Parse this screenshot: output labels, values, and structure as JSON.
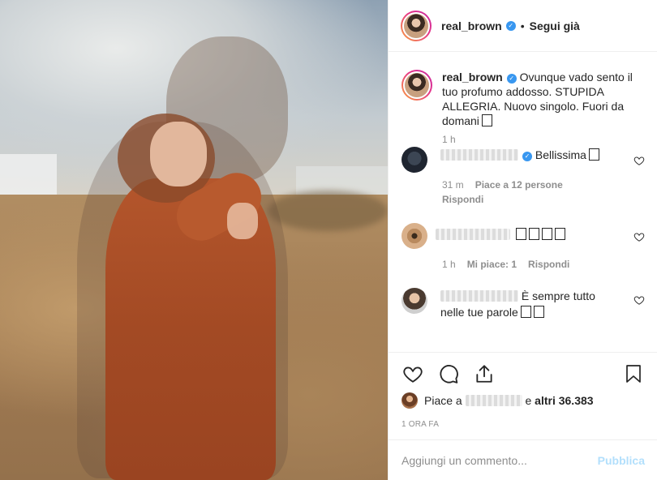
{
  "colors": {
    "verified": "#3897f0",
    "publish_disabled": "#b2dffc",
    "muted": "#8e8e8e"
  },
  "header": {
    "username": "real_brown",
    "separator": "•",
    "follow_label": "Segui già"
  },
  "caption": {
    "username": "real_brown",
    "text": "Ovunque vado sento il tuo profumo addosso. STUPIDA ALLEGRIA. Nuovo singolo. Fuori da domani",
    "time": "1 h"
  },
  "comments": [
    {
      "text": "Bellissima",
      "time": "31 m",
      "likes": "Piace a 12 persone",
      "reply": "Rispondi"
    },
    {
      "text": "",
      "time": "1 h",
      "likes": "Mi piace: 1",
      "reply": "Rispondi"
    },
    {
      "text": "È sempre tutto nelle tue parole"
    }
  ],
  "likes": {
    "prefix": "Piace a",
    "suffix": "e",
    "others": "altri 36.383"
  },
  "timestamp": "1 ORA FA",
  "comment_input": {
    "placeholder": "Aggiungi un commento...",
    "publish": "Pubblica"
  },
  "icons": [
    "heart-icon",
    "comment-icon",
    "share-icon",
    "bookmark-icon",
    "verified-icon"
  ]
}
